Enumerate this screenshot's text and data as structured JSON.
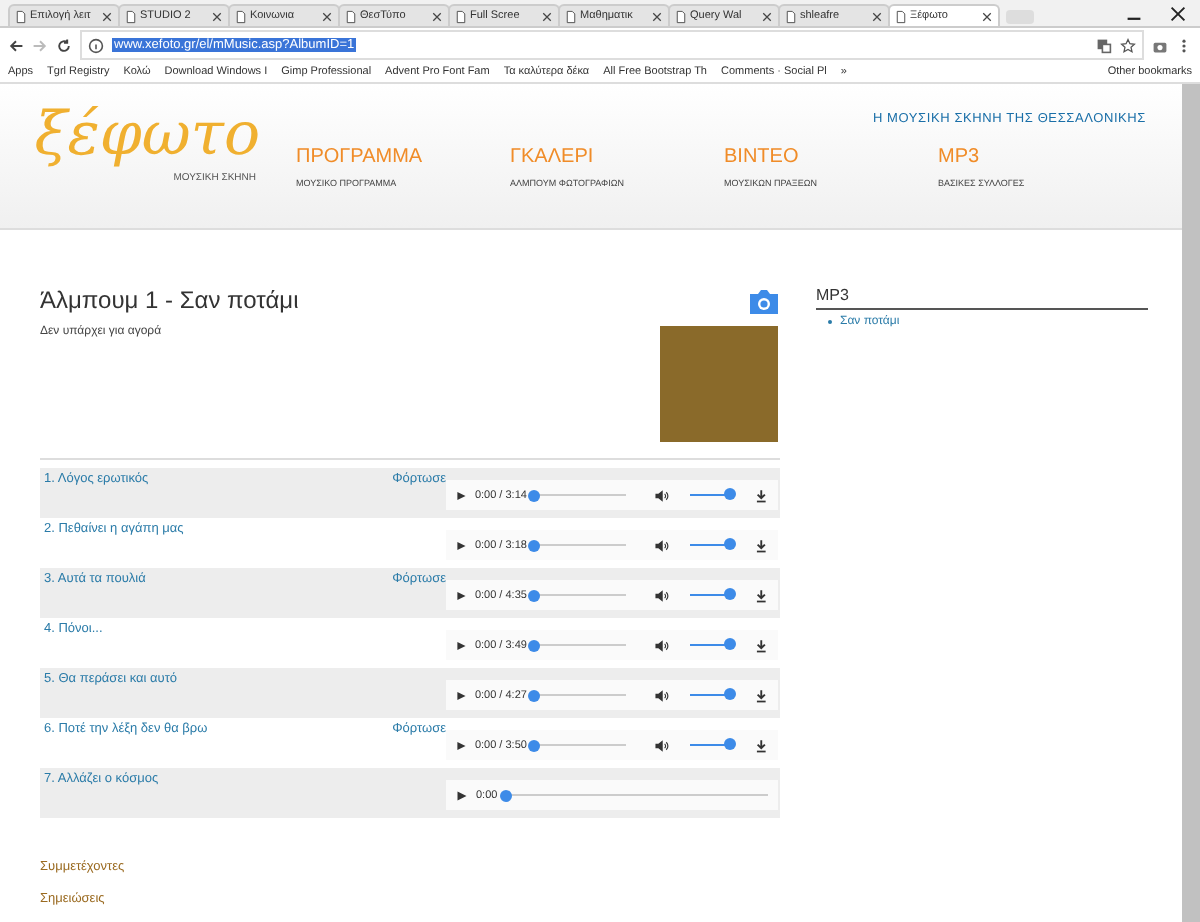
{
  "browser": {
    "tabs": [
      {
        "title": "Επιλογή λειτ",
        "selected": false
      },
      {
        "title": "STUDIO 2",
        "selected": false
      },
      {
        "title": "Κοινωνια",
        "selected": false
      },
      {
        "title": "ΘεσΤύπο",
        "selected": false
      },
      {
        "title": "Full Scree",
        "selected": false
      },
      {
        "title": "Μαθηματικ",
        "selected": false
      },
      {
        "title": "Query Wal",
        "selected": false
      },
      {
        "title": "shleafre",
        "selected": false
      },
      {
        "title": "Ξέφωτο",
        "selected": true
      }
    ],
    "url": "www.xefoto.gr/el/mMusic.asp?AlbumID=1",
    "bookmarks": [
      "Apps",
      "Tgrl Registry",
      "Κολώ",
      "Download Windows I",
      "Gimp Professional",
      "Advent Pro Font Fam",
      "Τα καλύτερα δέκα",
      "All Free Bootstrap Th",
      "Comments · Social Pl"
    ],
    "bookmarks_more": "»",
    "other_bookmarks": "Other bookmarks"
  },
  "header": {
    "logo": "ξέφωτο",
    "logo_subtitle": "ΜΟΥΣΙΚΗ ΣΚΗΝΗ",
    "tagline": "Η ΜΟΥΣΙΚΗ ΣΚΗΝΗ ΤΗΣ ΘΕΣΣΑΛΟΝΙΚΗΣ",
    "nav": [
      {
        "label": "ΠΡΟΓΡΑΜΜΑ",
        "sub": "ΜΟΥΣΙΚΟ ΠΡΟΓΡΑΜΜΑ"
      },
      {
        "label": "ΓΚΑΛΕΡΙ",
        "sub": "ΑΛΜΠΟΥΜ ΦΩΤΟΓΡΑΦΙΩΝ"
      },
      {
        "label": "ΒΙΝΤΕΟ",
        "sub": "ΜΟΥΣΙΚΩΝ ΠΡΑΞΕΩΝ"
      },
      {
        "label": "MP3",
        "sub": "ΒΑΣΙΚΕΣ ΣΥΛΛΟΓΕΣ"
      }
    ]
  },
  "album": {
    "title": "Άλμπουμ 1 - Σαν ποτάμι",
    "note": "Δεν υπάρχει για αγορά",
    "tracks": [
      {
        "kind": "full",
        "title": "1. Λόγος ερωτικός",
        "status": "Φόρτωσε",
        "time": "0:00 / 3:14",
        "level": 0,
        "volume": {
          "level": 1
        }
      },
      {
        "kind": "full",
        "title": "2. Πεθαίνει η αγάπη μας",
        "time": "0:00 / 3:18",
        "level": 0,
        "volume": {
          "level": 1
        }
      },
      {
        "kind": "full",
        "title": "3. Αυτά τα πουλιά",
        "status": "Φόρτωσε",
        "time": "0:00 / 4:35",
        "level": 0,
        "volume": {
          "level": 1
        }
      },
      {
        "kind": "full",
        "title": "4. Πόνοι...",
        "time": "0:00 / 3:49",
        "level": 0,
        "volume": {
          "level": 1
        }
      },
      {
        "kind": "full",
        "title": "5. Θα περάσει και αυτό",
        "time": "0:00 / 4:27",
        "level": 0,
        "volume": {
          "level": 1
        }
      },
      {
        "kind": "full",
        "title": "6. Ποτέ την λέξη δεν θα βρω",
        "status": "Φόρτωσε",
        "time": "0:00 / 3:50",
        "level": 0,
        "volume": {
          "level": 1
        }
      },
      {
        "kind": "compact",
        "title": "7. Αλλάζει ο κόσμος",
        "time": "0:00",
        "level": 0
      }
    ],
    "links": [
      "Συμμετέχοντες",
      "Σημειώσεις"
    ]
  },
  "sidebar": {
    "heading": "MP3",
    "items": [
      "Σαν ποτάμι"
    ]
  }
}
